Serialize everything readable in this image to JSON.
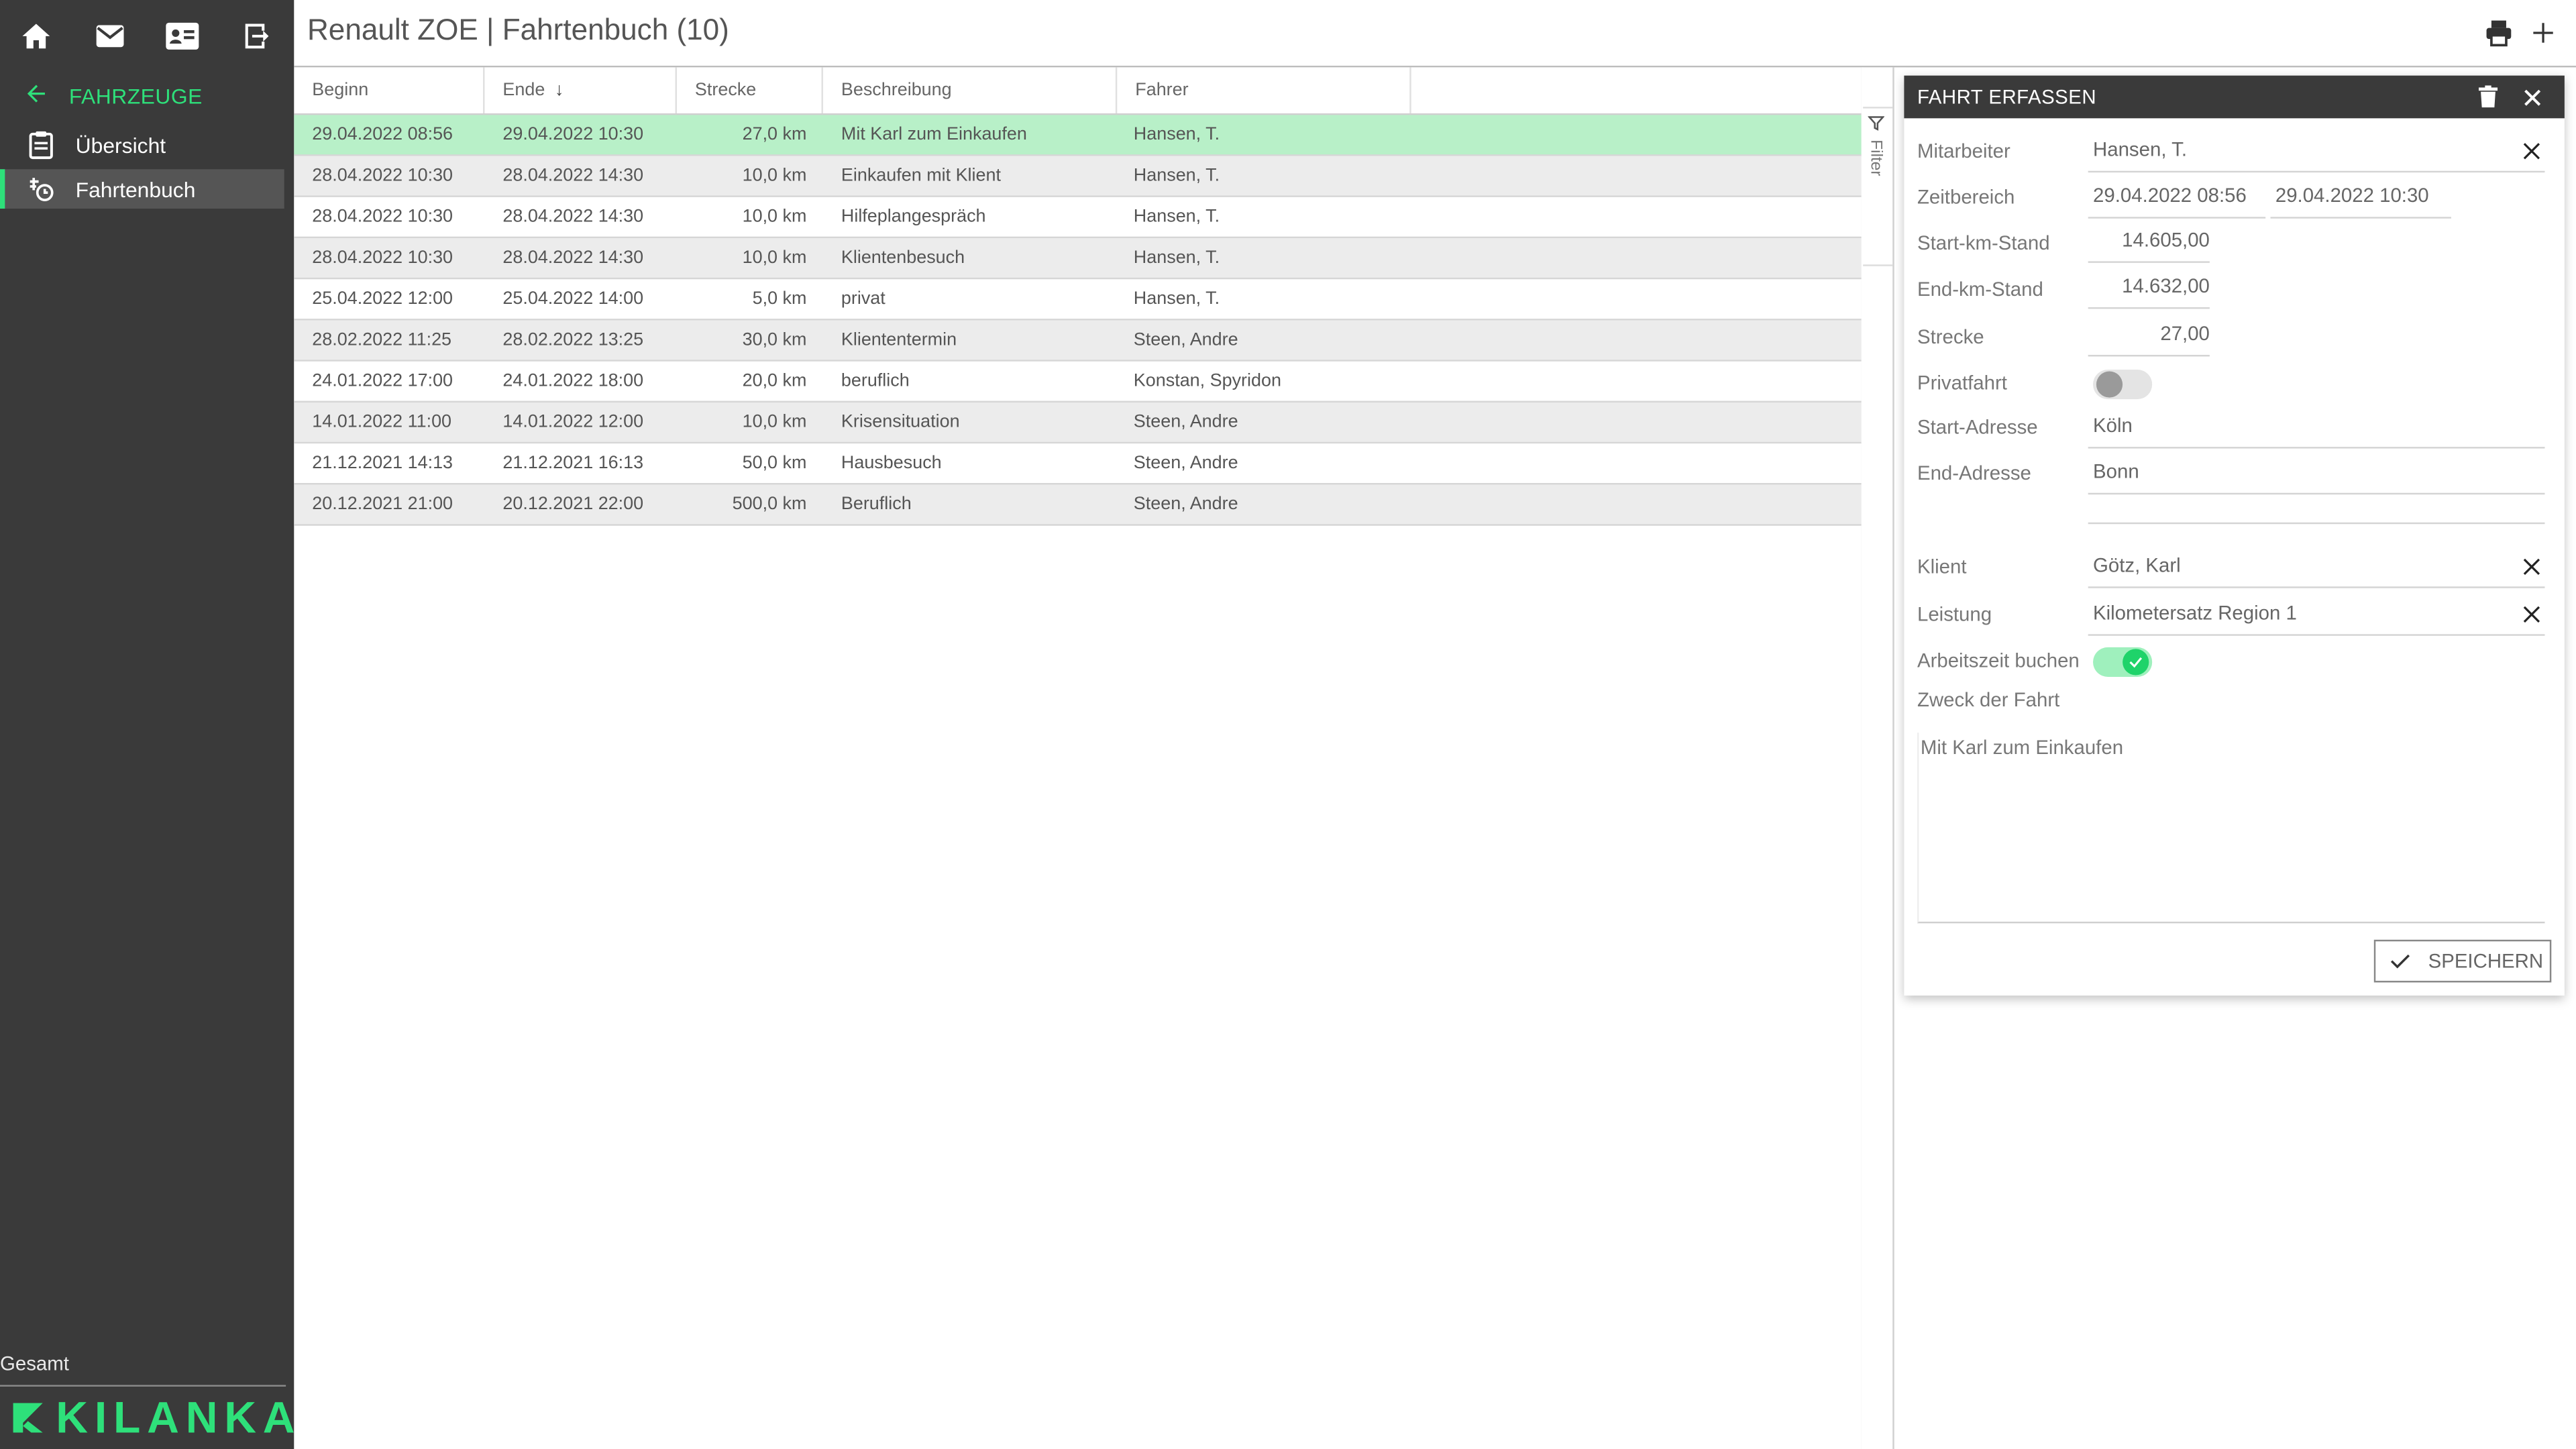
{
  "app": {
    "title": "Renault ZOE | Fahrtenbuch (10)",
    "brand": "KILANKA",
    "accent_color": "#2ee07a"
  },
  "sidebar": {
    "top_icons": [
      "home-icon",
      "mail-icon",
      "contact-card-icon",
      "logout-icon"
    ],
    "back_label": "FAHRZEUGE",
    "items": [
      {
        "label": "Übersicht",
        "icon": "clipboard-icon",
        "active": false
      },
      {
        "label": "Fahrtenbuch",
        "icon": "car-clock-icon",
        "active": true
      }
    ],
    "footer_label": "Gesamt"
  },
  "header": {
    "actions": [
      "print-icon",
      "plus-icon"
    ]
  },
  "table": {
    "columns": [
      "Beginn",
      "Ende",
      "Strecke",
      "Beschreibung",
      "Fahrer"
    ],
    "sorted_column": "Ende",
    "sort_direction": "desc",
    "rows": [
      {
        "beginn": "29.04.2022 08:56",
        "ende": "29.04.2022 10:30",
        "strecke": "27,0 km",
        "beschreibung": "Mit Karl zum Einkaufen",
        "fahrer": "Hansen, T."
      },
      {
        "beginn": "28.04.2022 10:30",
        "ende": "28.04.2022 14:30",
        "strecke": "10,0 km",
        "beschreibung": "Einkaufen mit Klient",
        "fahrer": "Hansen, T."
      },
      {
        "beginn": "28.04.2022 10:30",
        "ende": "28.04.2022 14:30",
        "strecke": "10,0 km",
        "beschreibung": "Hilfeplangespräch",
        "fahrer": "Hansen, T."
      },
      {
        "beginn": "28.04.2022 10:30",
        "ende": "28.04.2022 14:30",
        "strecke": "10,0 km",
        "beschreibung": "Klientenbesuch",
        "fahrer": "Hansen, T."
      },
      {
        "beginn": "25.04.2022 12:00",
        "ende": "25.04.2022 14:00",
        "strecke": "5,0 km",
        "beschreibung": "privat",
        "fahrer": "Hansen, T."
      },
      {
        "beginn": "28.02.2022 11:25",
        "ende": "28.02.2022 13:25",
        "strecke": "30,0 km",
        "beschreibung": "Kliententermin",
        "fahrer": "Steen, Andre"
      },
      {
        "beginn": "24.01.2022 17:00",
        "ende": "24.01.2022 18:00",
        "strecke": "20,0 km",
        "beschreibung": "beruflich",
        "fahrer": "Konstan, Spyridon"
      },
      {
        "beginn": "14.01.2022 11:00",
        "ende": "14.01.2022 12:00",
        "strecke": "10,0 km",
        "beschreibung": "Krisensituation",
        "fahrer": "Steen, Andre"
      },
      {
        "beginn": "21.12.2021 14:13",
        "ende": "21.12.2021 16:13",
        "strecke": "50,0 km",
        "beschreibung": "Hausbesuch",
        "fahrer": "Steen, Andre"
      },
      {
        "beginn": "20.12.2021 21:00",
        "ende": "20.12.2021 22:00",
        "strecke": "500,0 km",
        "beschreibung": "Beruflich",
        "fahrer": "Steen, Andre"
      }
    ],
    "filter_label": "Filter"
  },
  "panel": {
    "title": "FAHRT ERFASSEN",
    "fields": {
      "mitarbeiter": {
        "label": "Mitarbeiter",
        "value": "Hansen, T."
      },
      "zeitbereich": {
        "label": "Zeitbereich",
        "start": "29.04.2022 08:56",
        "end": "29.04.2022 10:30"
      },
      "start_km": {
        "label": "Start-km-Stand",
        "value": "14.605,00"
      },
      "end_km": {
        "label": "End-km-Stand",
        "value": "14.632,00"
      },
      "strecke": {
        "label": "Strecke",
        "value": "27,00"
      },
      "privatfahrt": {
        "label": "Privatfahrt",
        "checked": false
      },
      "start_adresse": {
        "label": "Start-Adresse",
        "value": "Köln"
      },
      "end_adresse": {
        "label": "End-Adresse",
        "value": "Bonn"
      },
      "klient": {
        "label": "Klient",
        "value": "Götz, Karl"
      },
      "leistung": {
        "label": "Leistung",
        "value": "Kilometersatz Region 1"
      },
      "arbeitszeit": {
        "label": "Arbeitszeit buchen",
        "checked": true
      },
      "zweck": {
        "label": "Zweck der Fahrt",
        "value": "Mit Karl zum Einkaufen"
      }
    },
    "save_label": "SPEICHERN"
  }
}
